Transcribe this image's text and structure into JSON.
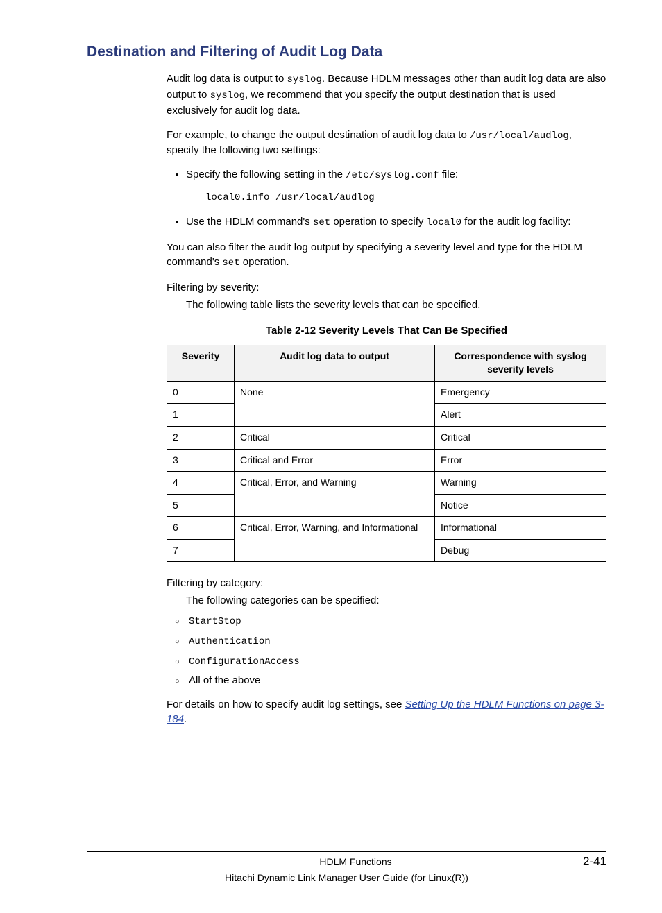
{
  "heading": "Destination and Filtering of Audit Log Data",
  "para1a": "Audit log data is output to ",
  "para1_code1": "syslog",
  "para1b": ". Because HDLM messages other than audit log data are also output to ",
  "para1_code2": "syslog",
  "para1c": ", we recommend that you specify the output destination that is used exclusively for audit log data.",
  "para2a": "For example, to change the output destination of audit log data to ",
  "para2_code1": "/usr/local/audlog",
  "para2b": ", specify the following two settings:",
  "bullet1a": "Specify the following setting in the ",
  "bullet1_code": "/etc/syslog.conf",
  "bullet1b": " file:",
  "codeblock1": "local0.info /usr/local/audlog",
  "bullet2a": "Use the HDLM command's ",
  "bullet2_code1": "set",
  "bullet2b": " operation to specify ",
  "bullet2_code2": "local0",
  "bullet2c": " for the audit log facility:",
  "para3a": "You can also filter the audit log output by specifying a severity level and type for the HDLM command's ",
  "para3_code": "set",
  "para3b": " operation.",
  "filter_sev_term": "Filtering by severity:",
  "filter_sev_def": "The following table lists the severity levels that can be specified.",
  "table_caption": "Table 2-12 Severity Levels That Can Be Specified",
  "table": {
    "headers": [
      "Severity",
      "Audit log data to output",
      "Correspondence with syslog severity levels"
    ],
    "rows": [
      {
        "sev": "0",
        "out": "None",
        "corr": "Emergency",
        "merge": "top"
      },
      {
        "sev": "1",
        "out": "",
        "corr": "Alert",
        "merge": "bottom"
      },
      {
        "sev": "2",
        "out": "Critical",
        "corr": "Critical",
        "merge": ""
      },
      {
        "sev": "3",
        "out": "Critical and Error",
        "corr": "Error",
        "merge": ""
      },
      {
        "sev": "4",
        "out": "Critical, Error, and Warning",
        "corr": "Warning",
        "merge": "top"
      },
      {
        "sev": "5",
        "out": "",
        "corr": "Notice",
        "merge": "bottom"
      },
      {
        "sev": "6",
        "out": "Critical, Error, Warning, and Informational",
        "corr": "Informational",
        "merge": "top"
      },
      {
        "sev": "7",
        "out": "",
        "corr": "Debug",
        "merge": "bottom"
      }
    ]
  },
  "filter_cat_term": "Filtering by category:",
  "filter_cat_def": "The following categories can be specified:",
  "cat_items": [
    "StartStop",
    "Authentication",
    "ConfigurationAccess",
    "All of the above"
  ],
  "para4a": "For details on how to specify audit log settings, see ",
  "para4_link": "Setting Up the HDLM Functions on page 3-184",
  "para4b": ".",
  "footer": {
    "section": "HDLM Functions",
    "page": "2-41",
    "book": "Hitachi Dynamic Link Manager User Guide (for Linux(R))"
  }
}
